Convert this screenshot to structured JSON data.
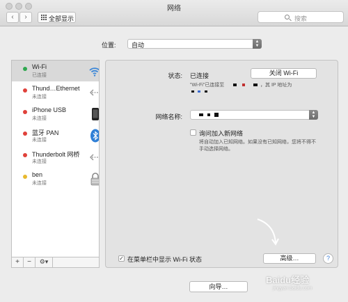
{
  "window": {
    "title": "网络"
  },
  "toolbar": {
    "back": "‹",
    "forward": "›",
    "show_all": "全部显示",
    "search_placeholder": "搜索"
  },
  "location": {
    "label": "位置:",
    "value": "自动"
  },
  "services": [
    {
      "name": "Wi-Fi",
      "status": "已连接",
      "color": "#2fa84f",
      "icon": "wifi-icon"
    },
    {
      "name": "Thund…Ethernet",
      "status": "未连接",
      "color": "#e0413a",
      "icon": "ethernet-arrows-icon"
    },
    {
      "name": "iPhone USB",
      "status": "未连接",
      "color": "#e0413a",
      "icon": "iphone-icon"
    },
    {
      "name": "蓝牙 PAN",
      "status": "未连接",
      "color": "#e0413a",
      "icon": "bluetooth-icon"
    },
    {
      "name": "Thunderbolt 网桥",
      "status": "未连接",
      "color": "#e0413a",
      "icon": "thunderbolt-arrows-icon"
    },
    {
      "name": "ben",
      "status": "未连接",
      "color": "#e8b92e",
      "icon": "vpn-lock-icon"
    }
  ],
  "sidebar_tools": {
    "add": "+",
    "remove": "−",
    "gear": "⚙▾"
  },
  "detail": {
    "status_label": "状态:",
    "status_value": "已连接",
    "turn_off_button": "关闭 Wi-Fi",
    "status_desc_1": "\"Wi-Fi\"已连接至",
    "status_desc_2": "，其 IP 地址为",
    "network_name_label": "网络名称:",
    "ask_join_label": "询问加入新网络",
    "ask_join_desc": "将自动加入已知网络。如果没有已知网络，您将不得不手动选择网络。",
    "show_in_menubar_label": "在菜单栏中显示 Wi-Fi 状态",
    "advanced_button": "高级…",
    "help_button": "?"
  },
  "footer": {
    "assistant_button": "向导…"
  },
  "watermark": {
    "text": "Baidu经验",
    "sub": "jingyan.baidu.com"
  }
}
